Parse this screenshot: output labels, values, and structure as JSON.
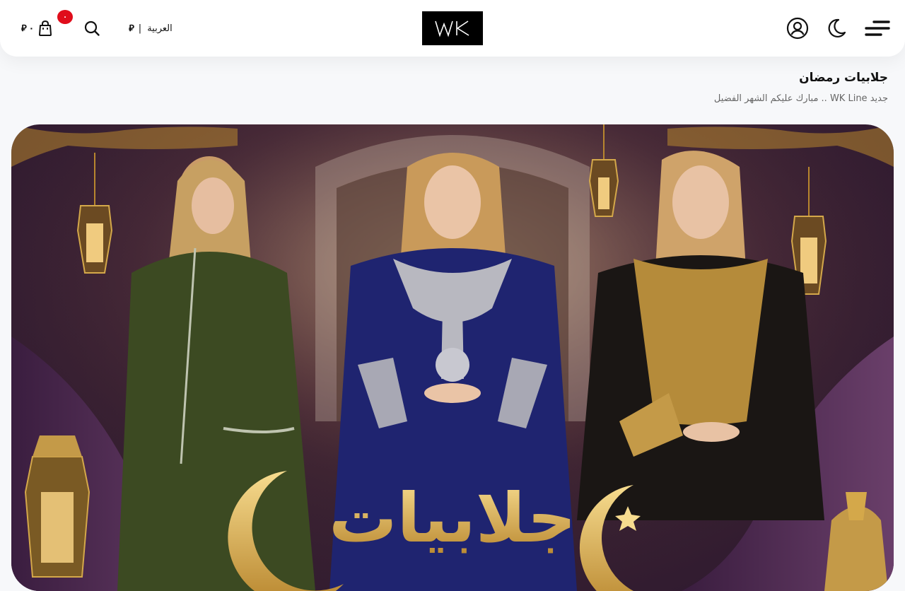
{
  "header": {
    "currency_symbol": "⃁",
    "cart_amount": "٠",
    "cart_count": "٠",
    "language_label": "العربية",
    "language_separator": "|",
    "logo_text": "WK"
  },
  "banner": {
    "title": "جلابيات رمضان",
    "subtitle": "جديد WK Line .. مبارك عليكم الشهر الفضيل",
    "image_text": "جلابيات"
  },
  "colors": {
    "accent_red": "#e00d1b",
    "logo_bg": "#000000",
    "gold": "#d4a84a"
  },
  "icons": {
    "menu": "hamburger-menu-icon",
    "theme": "moon-icon",
    "account": "user-circle-icon",
    "search": "search-icon",
    "cart": "shopping-bag-icon"
  }
}
